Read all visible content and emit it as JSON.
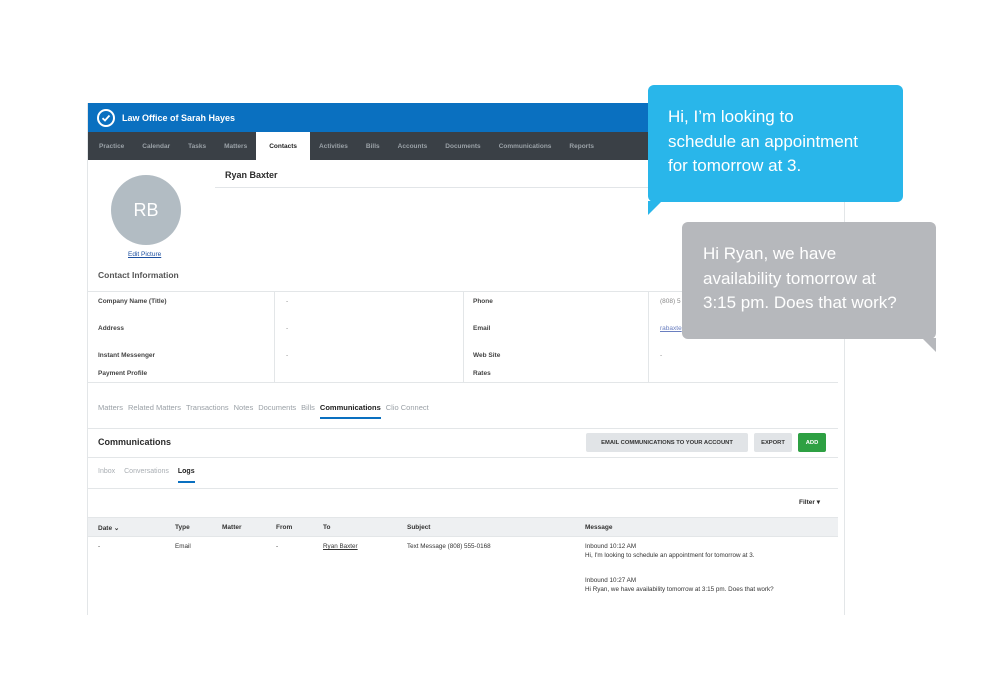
{
  "app": {
    "firm_name": "Law Office of Sarah Hayes"
  },
  "nav": [
    "Practice",
    "Calendar",
    "Tasks",
    "Matters",
    "Contacts",
    "Activities",
    "Bills",
    "Accounts",
    "Documents",
    "Communications",
    "Reports"
  ],
  "nav_active": "Contacts",
  "contact": {
    "initials": "RB",
    "name": "Ryan Baxter",
    "edit_picture": "Edit Picture"
  },
  "contact_info": {
    "title": "Contact Information",
    "company_label": "Company Name (Title)",
    "company_value": "-",
    "address_label": "Address",
    "address_value": "-",
    "im_label": "Instant Messenger",
    "im_value": "-",
    "payment_label": "Payment Profile",
    "phone_label": "Phone",
    "phone_value": "(808) 5",
    "email_label": "Email",
    "email_value": "rabaxte",
    "website_label": "Web Site",
    "website_value": "-",
    "rates_label": "Rates"
  },
  "subtabs": [
    "Matters",
    "Related Matters",
    "Transactions",
    "Notes",
    "Documents",
    "Bills",
    "Communications",
    "Clio Connect"
  ],
  "subtab_active": "Communications",
  "communications": {
    "title": "Communications",
    "email_button": "EMAIL COMMUNICATIONS TO YOUR ACCOUNT",
    "export_button": "EXPORT",
    "add_button": "ADD",
    "tabs": [
      "Inbox",
      "Conversations",
      "Logs"
    ],
    "tab_active": "Logs",
    "filter_label": "Filter ▾"
  },
  "table": {
    "headers": {
      "date": "Date ⌄",
      "type": "Type",
      "matter": "Matter",
      "from": "From",
      "to": "To",
      "subject": "Subject",
      "message": "Message"
    },
    "row": {
      "date": "-",
      "type": "Email",
      "matter": "",
      "from": "-",
      "to": "Ryan Baxter",
      "subject": "Text Message (808) 555-0168",
      "msg1_head": "Inbound 10:12 AM",
      "msg1_body": "Hi, I'm looking to schedule an appointment for tomorrow at 3.",
      "msg2_head": "Inbound 10:27 AM",
      "msg2_body": "Hi Ryan, we have availability tomorrow at 3:15 pm. Does that work?"
    }
  },
  "bubbles": {
    "client_line1": "Hi, I’m looking to",
    "client_line2": "schedule an appointment",
    "client_line3": "for tomorrow at 3.",
    "office_line1": "Hi Ryan, we have",
    "office_line2": "availability tomorrow at",
    "office_line3": "3:15 pm. Does that work?"
  },
  "colors": {
    "brand_blue": "#0a70c0",
    "nav_bg": "#3a4046",
    "add_green": "#2ea043",
    "client_bubble": "#29b6ea",
    "office_bubble": "#b6b8bc"
  }
}
